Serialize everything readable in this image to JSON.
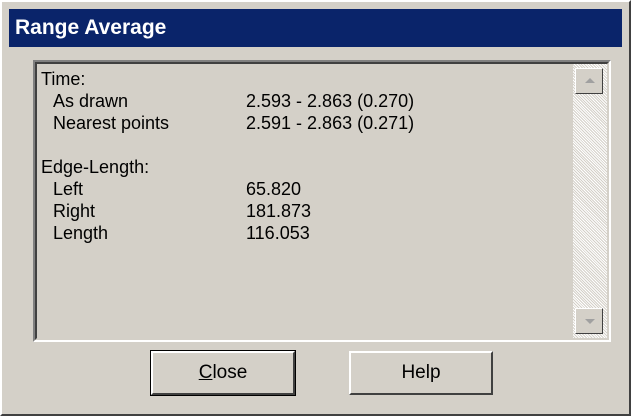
{
  "window": {
    "title": "Range Average"
  },
  "report": {
    "time_heading": "Time:",
    "as_drawn_label": "As drawn",
    "as_drawn_value": "2.593 - 2.863 (0.270)",
    "nearest_label": "Nearest points",
    "nearest_value": "2.591 - 2.863 (0.271)",
    "edge_heading": "Edge-Length:",
    "left_label": "Left",
    "left_value": "65.820",
    "right_label": "Right",
    "right_value": "181.873",
    "length_label": "Length",
    "length_value": "116.053"
  },
  "buttons": {
    "close_mnemonic": "C",
    "close_rest": "lose",
    "help_label": "Help"
  },
  "icons": {
    "scroll_up": "arrow-up-icon",
    "scroll_down": "arrow-down-icon"
  }
}
